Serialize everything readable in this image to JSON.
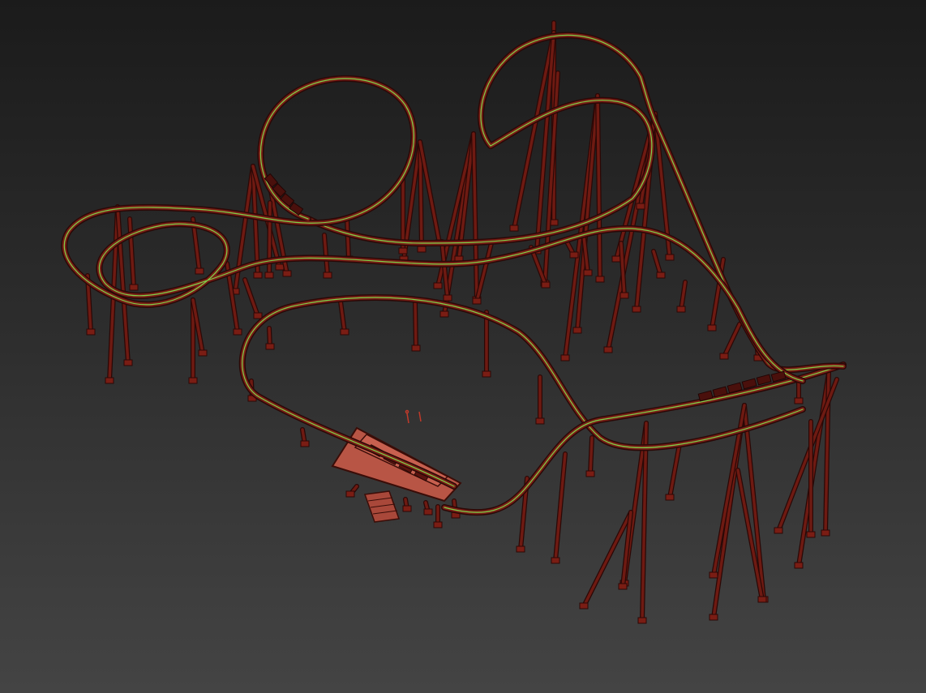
{
  "viewport": {
    "label": "",
    "colors": {
      "background_top": "#1b1b1b",
      "background_bottom": "#444444",
      "support": "#6e1a12",
      "support_edge": "#2a0806",
      "track_under": "#2a0806",
      "track_mid": "#7a1f16",
      "track_rail": "#7fd24a",
      "station": "#b85545",
      "station_edge": "#3a0d08",
      "train": "#5a140f"
    },
    "objects": [
      "roller-coaster-track",
      "vertical-loop",
      "helix",
      "lift-hill",
      "station-platform",
      "train",
      "support-columns"
    ]
  }
}
